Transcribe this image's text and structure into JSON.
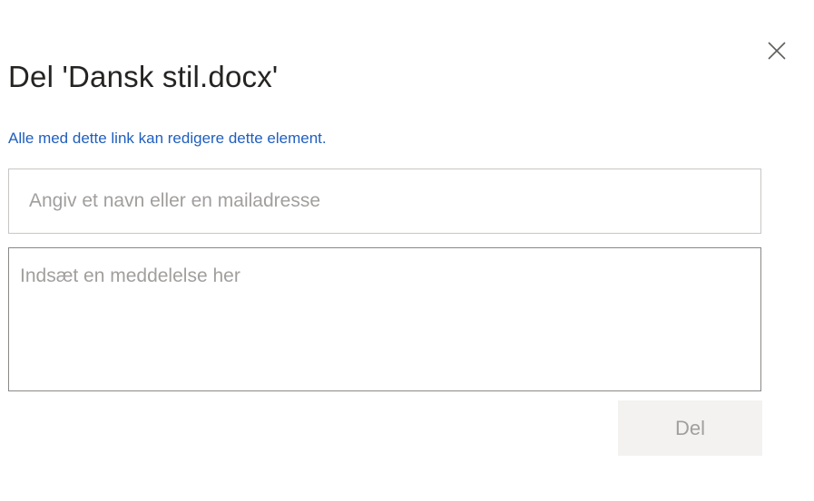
{
  "dialog": {
    "title": "Del 'Dansk stil.docx'",
    "close_icon": "close-icon",
    "info_text": "Alle med dette link kan redigere dette element."
  },
  "recipient": {
    "placeholder": "Angiv et navn eller en mailadresse",
    "value": ""
  },
  "message": {
    "placeholder": "Indsæt en meddelelse her",
    "value": ""
  },
  "actions": {
    "share_label": "Del",
    "share_enabled": false
  },
  "colors": {
    "link_blue": "#1f5fbf",
    "placeholder_gray": "#a19f9d",
    "disabled_button_bg": "#f3f2f1",
    "title_text": "#252423"
  }
}
